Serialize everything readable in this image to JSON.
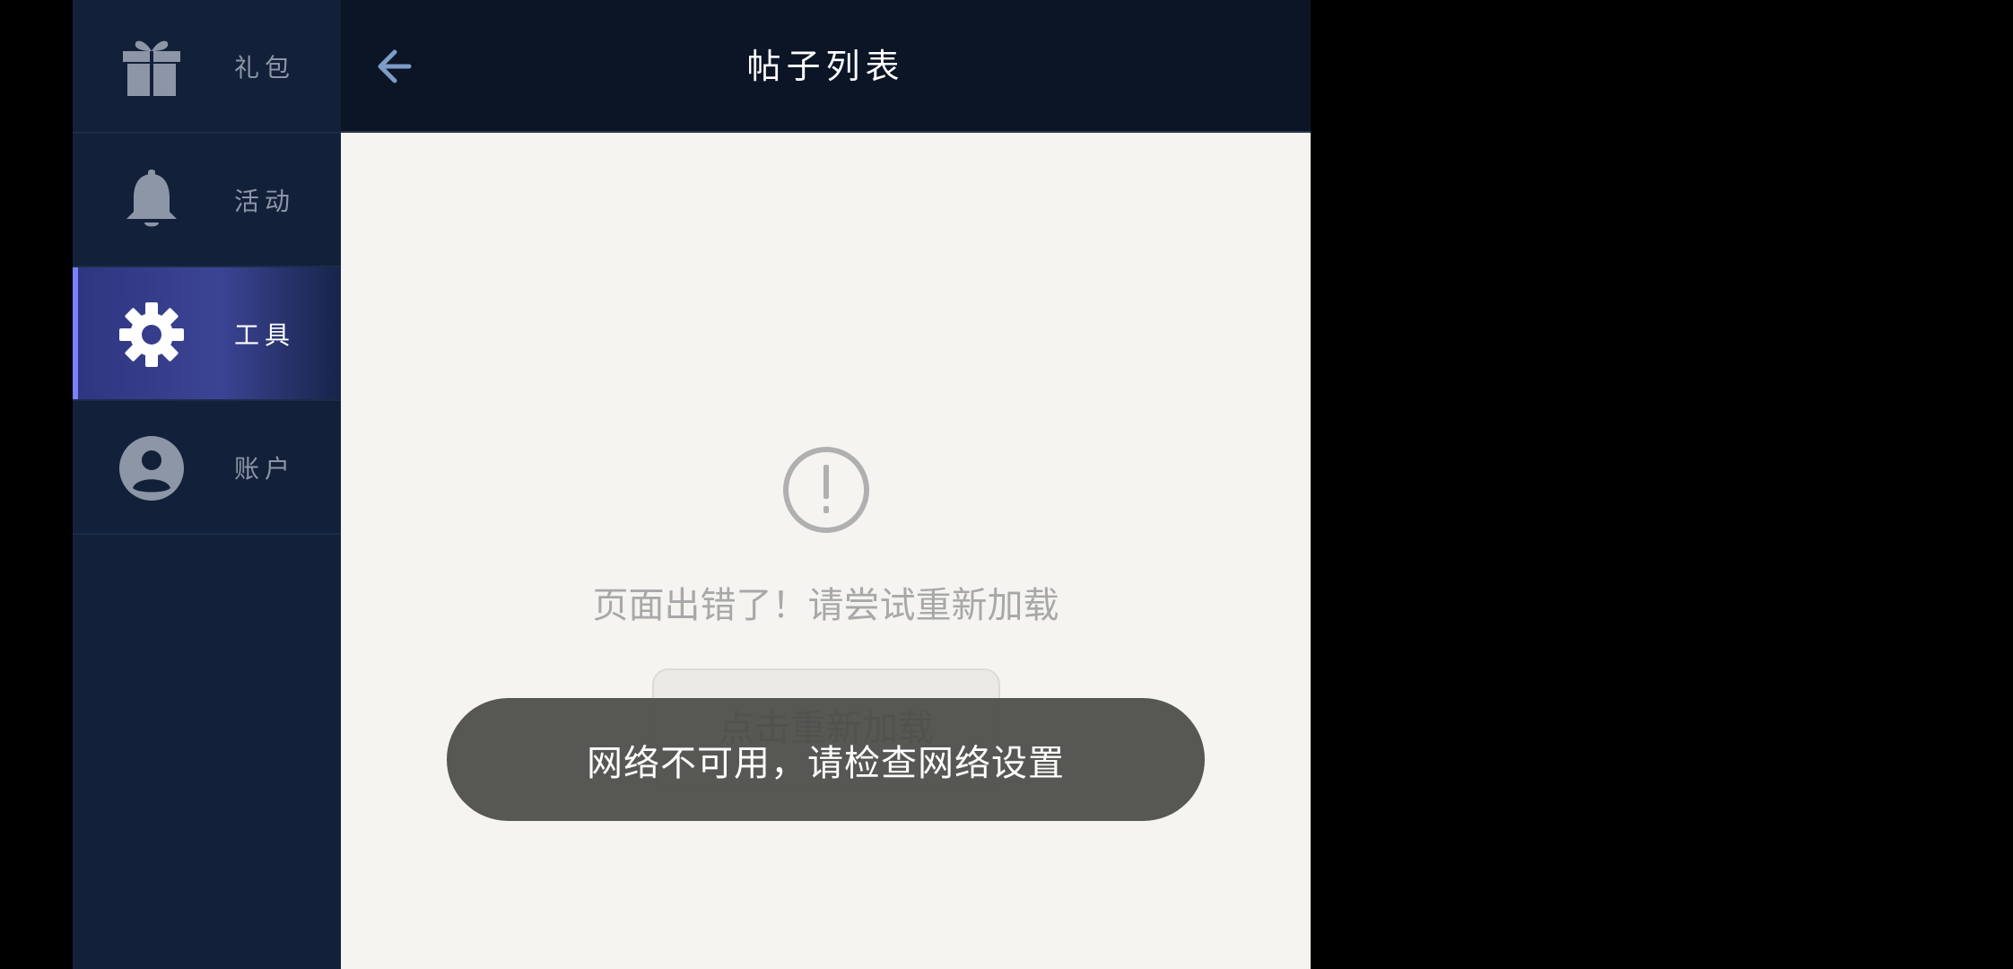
{
  "sidebar": {
    "items": [
      {
        "label": "礼包",
        "icon": "gift-icon",
        "active": false
      },
      {
        "label": "活动",
        "icon": "bell-icon",
        "active": false
      },
      {
        "label": "工具",
        "icon": "gear-icon",
        "active": true
      },
      {
        "label": "账户",
        "icon": "account-icon",
        "active": false
      }
    ]
  },
  "header": {
    "title": "帖子列表",
    "back_icon": "arrow-left-icon"
  },
  "main": {
    "error_icon": "exclamation-circle-icon",
    "error_message": "页面出错了！请尝试重新加载",
    "reload_label": "点击重新加载"
  },
  "toast": {
    "message": "网络不可用，请检查网络设置"
  },
  "colors": {
    "sidebar_bg": "#12203a",
    "header_bg": "#0b1526",
    "active_accent": "#7b80ff",
    "content_bg": "#f5f4f0",
    "reload_text": "#1f6b33",
    "toast_bg": "#52524e"
  }
}
